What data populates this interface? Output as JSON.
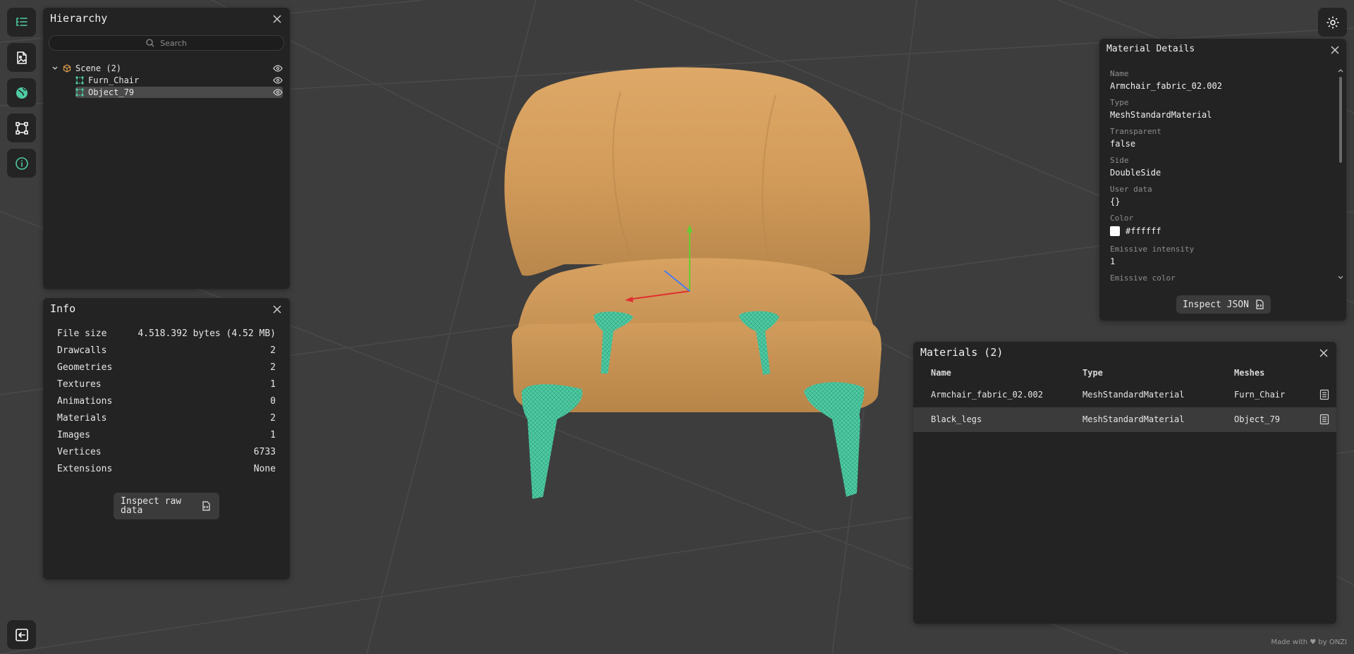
{
  "colors": {
    "accent": "#4ecba3",
    "panel": "#232323",
    "viewport": "#3d3d3d",
    "chair": "#d5a05e",
    "scene_icon": "#e2a04f"
  },
  "sidebar": {
    "items": [
      {
        "icon": "hierarchy-list-icon"
      },
      {
        "icon": "file-image-icon"
      },
      {
        "icon": "globe-icon"
      },
      {
        "icon": "transform-bounds-icon"
      },
      {
        "icon": "info-icon"
      }
    ],
    "bottom_icon": "exit-icon"
  },
  "hierarchy": {
    "title": "Hierarchy",
    "search_placeholder": "Search",
    "scene_label": "Scene (2)",
    "children": [
      {
        "label": "Furn_Chair",
        "selected": false
      },
      {
        "label": "Object_79",
        "selected": true
      }
    ]
  },
  "info": {
    "title": "Info",
    "rows": [
      {
        "label": "File size",
        "value": "4.518.392 bytes (4.52 MB)"
      },
      {
        "label": "Drawcalls",
        "value": "2"
      },
      {
        "label": "Geometries",
        "value": "2"
      },
      {
        "label": "Textures",
        "value": "1"
      },
      {
        "label": "Animations",
        "value": "0"
      },
      {
        "label": "Materials",
        "value": "2"
      },
      {
        "label": "Images",
        "value": "1"
      },
      {
        "label": "Vertices",
        "value": "6733"
      },
      {
        "label": "Extensions",
        "value": "None"
      }
    ],
    "inspect_button": "Inspect raw data"
  },
  "material_details": {
    "title": "Material Details",
    "fields": [
      {
        "label": "Name",
        "value": "Armchair_fabric_02.002"
      },
      {
        "label": "Type",
        "value": "MeshStandardMaterial"
      },
      {
        "label": "Transparent",
        "value": "false"
      },
      {
        "label": "Side",
        "value": "DoubleSide"
      },
      {
        "label": "User data",
        "value": "{}"
      },
      {
        "label": "Color",
        "value": "#ffffff"
      },
      {
        "label": "Emissive intensity",
        "value": "1"
      },
      {
        "label": "Emissive color",
        "value": ""
      }
    ],
    "inspect_button": "Inspect JSON"
  },
  "materials": {
    "title": "Materials (2)",
    "columns": [
      "Name",
      "Type",
      "Meshes"
    ],
    "rows": [
      {
        "name": "Armchair_fabric_02.002",
        "type": "MeshStandardMaterial",
        "meshes": "Furn_Chair",
        "selected": false
      },
      {
        "name": "Black_legs",
        "type": "MeshStandardMaterial",
        "meshes": "Object_79",
        "selected": true
      }
    ]
  },
  "footer": {
    "prefix": "Made with",
    "suffix": "by ONZI"
  }
}
